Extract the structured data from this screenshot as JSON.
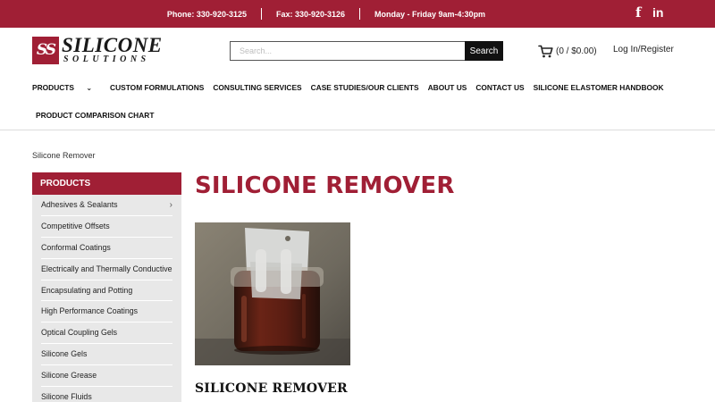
{
  "topbar": {
    "phone": "Phone: 330-920-3125",
    "fax": "Fax: 330-920-3126",
    "hours": "Monday - Friday 9am-4:30pm",
    "social": {
      "facebook": "f",
      "linkedin": "in"
    }
  },
  "logo": {
    "mark": "SS",
    "word1": "SILICONE",
    "word2": "SOLUTIONS"
  },
  "search": {
    "placeholder": "Search...",
    "button": "Search"
  },
  "cart": {
    "label": "(0 / $0.00)"
  },
  "account": {
    "login": "Log In/Register"
  },
  "nav": {
    "items": [
      "PRODUCTS",
      "CUSTOM FORMULATIONS",
      "CONSULTING SERVICES",
      "CASE STUDIES/OUR CLIENTS",
      "ABOUT US",
      "CONTACT US",
      "SILICONE ELASTOMER HANDBOOK"
    ],
    "second_row": "PRODUCT COMPARISON CHART",
    "dropdown_chevron": "⌄"
  },
  "breadcrumb": "Silicone Remover",
  "sidebar": {
    "title": "PRODUCTS",
    "items": [
      "Adhesives & Sealants",
      "Competitive Offsets",
      "Conformal Coatings",
      "Electrically and Thermally Conductive",
      "Encapsulating and Potting",
      "High Performance Coatings",
      "Optical Coupling Gels",
      "Silicone Gels",
      "Silicone Grease",
      "Silicone Fluids"
    ],
    "expand_arrow": "›"
  },
  "main": {
    "title": "SILICONE REMOVER",
    "subtitle": "SILICONE REMOVER"
  },
  "colors": {
    "brand": "#a01f35",
    "sidebar_bg": "#e8e8e8"
  }
}
